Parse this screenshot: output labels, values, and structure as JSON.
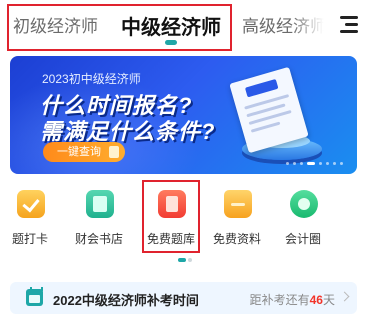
{
  "tabs": [
    {
      "label": "初级经济师",
      "active": false
    },
    {
      "label": "中级经济师",
      "active": true
    },
    {
      "label": "高级经济师",
      "active": false
    }
  ],
  "banner": {
    "subtitle": "2023初中级经济师",
    "headline_1": "什么时间报名?",
    "headline_2": "需满足什么条件?",
    "button_label": "一键查询"
  },
  "quick_links": [
    {
      "label": "题打卡",
      "icon": "checkbox-icon"
    },
    {
      "label": "财会书店",
      "icon": "book-icon"
    },
    {
      "label": "免费题库",
      "icon": "question-bank-icon"
    },
    {
      "label": "免费资料",
      "icon": "folder-icon"
    },
    {
      "label": "会计圈",
      "icon": "community-icon"
    }
  ],
  "notice": {
    "title": "2022中级经济师补考时间",
    "countdown_prefix": "距补考还有",
    "countdown_days": "46",
    "countdown_suffix": "天"
  },
  "colors": {
    "accent": "#1ea7a7",
    "highlight_box": "#e0232e",
    "countdown_number": "#f2352a",
    "banner_button": "#ff8a1a"
  }
}
